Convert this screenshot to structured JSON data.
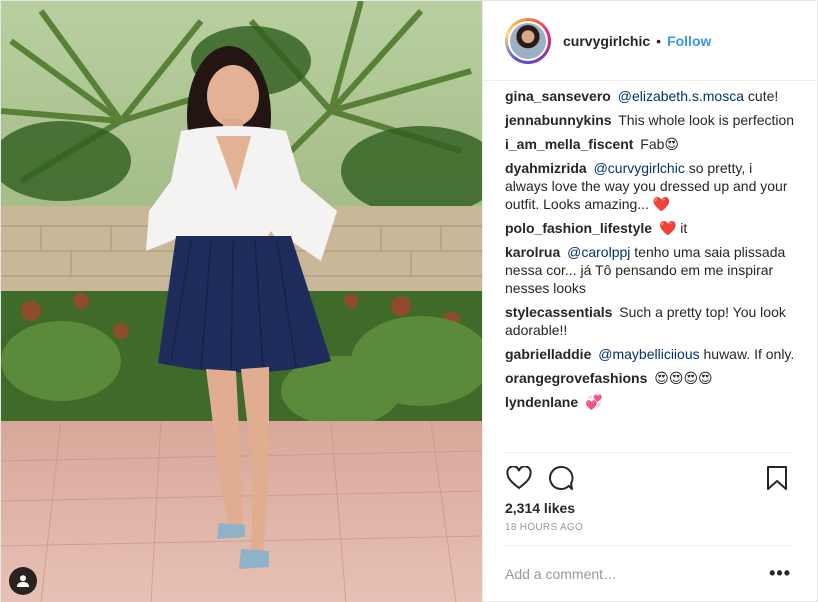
{
  "post": {
    "author": "curvygirlchic",
    "follow_label": "Follow",
    "separator": "•",
    "likes": "2,314 likes",
    "timestamp": "18 HOURS AGO",
    "comment_placeholder": "Add a comment…",
    "more_label": "•••"
  },
  "comments": [
    {
      "user": "gina_sansevero",
      "mention": "@elizabeth.s.mosca",
      "text": " cute!"
    },
    {
      "user": "jennabunnykins",
      "mention": "",
      "text": "This whole look is perfection"
    },
    {
      "user": "i_am_mella_fiscent",
      "mention": "",
      "text": "Fab😍"
    },
    {
      "user": "dyahmizrida",
      "mention": "@curvygirlchic",
      "text": " so pretty, i always love the way you dressed up and your outfit. Looks amazing... ❤️"
    },
    {
      "user": "polo_fashion_lifestyle",
      "mention": "",
      "text": "❤️ it"
    },
    {
      "user": "karolrua",
      "mention": "@carolppj",
      "text": " tenho uma saia plissada nessa cor... já Tô pensando em me inspirar nesses looks"
    },
    {
      "user": "stylecassentials",
      "mention": "",
      "text": "Such a pretty top! You look adorable!!"
    },
    {
      "user": "gabrielladdie",
      "mention": "@maybelliciious",
      "text": " huwaw. If only."
    },
    {
      "user": "orangegrovefashions",
      "mention": "",
      "text": "😍😍😍😍"
    },
    {
      "user": "lyndenlane",
      "mention": "",
      "text": "💞"
    }
  ],
  "icons": {
    "tag": "user-tag-icon",
    "like": "heart-icon",
    "comment": "comment-bubble-icon",
    "save": "bookmark-icon"
  },
  "colors": {
    "follow": "#3897f0",
    "mention": "#003569",
    "muted": "#999999",
    "border": "#efefef"
  }
}
